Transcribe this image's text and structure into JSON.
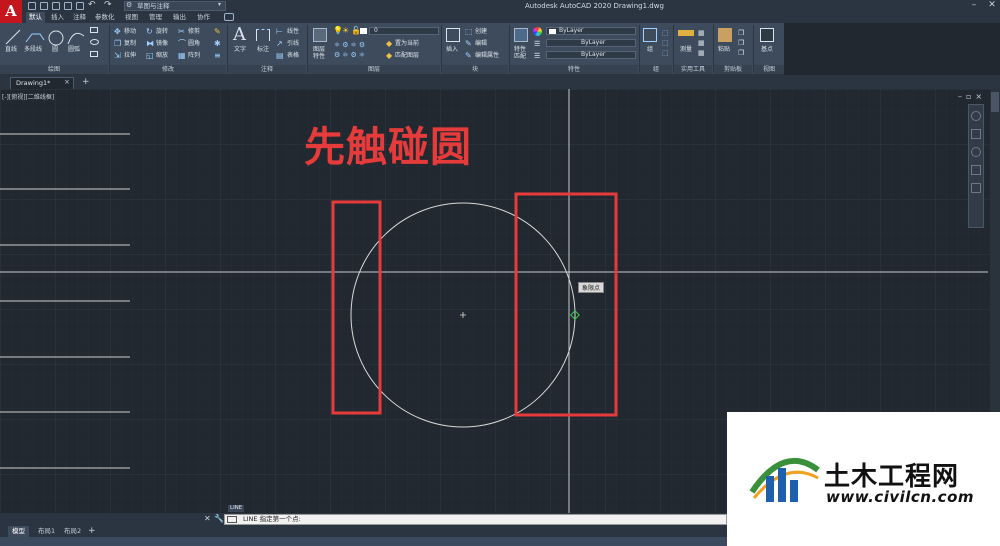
{
  "app": {
    "logo_letter": "A",
    "title": "Autodesk AutoCAD 2020    Drawing1.dwg",
    "workspace": "草图与注释"
  },
  "ribbon_tabs": [
    "默认",
    "插入",
    "注释",
    "参数化",
    "视图",
    "管理",
    "输出",
    "协作"
  ],
  "ribbon": {
    "draw": {
      "title": "绘图",
      "tools": [
        "直线",
        "多段线",
        "圆",
        "圆弧"
      ]
    },
    "modify": {
      "title": "修改",
      "rows": [
        [
          "移动",
          "旋转",
          "修剪"
        ],
        [
          "复制",
          "镜像",
          "圆角"
        ],
        [
          "拉伸",
          "缩放",
          "阵列"
        ]
      ]
    },
    "annotation": {
      "title": "注释",
      "tools": [
        "文字",
        "标注"
      ],
      "small": [
        "线性",
        "引线",
        "表格"
      ]
    },
    "layers": {
      "title": "图层",
      "big": "图层特性",
      "layer_value": "0",
      "small": [
        "置为当前",
        "匹配图层"
      ]
    },
    "block": {
      "title": "块",
      "big": "插入",
      "small": [
        "创建",
        "编辑",
        "编辑属性"
      ]
    },
    "properties": {
      "title": "特性",
      "big": "特性匹配",
      "rows": [
        "ByLayer",
        "ByLayer",
        "ByLayer"
      ]
    },
    "groups": {
      "title": "组",
      "big": "组"
    },
    "utilities": {
      "title": "实用工具",
      "big": "测量"
    },
    "clipboard": {
      "title": "剪贴板",
      "big": "粘贴"
    },
    "view": {
      "title": "视图",
      "big": "基点"
    }
  },
  "doc_tab": {
    "label": "Drawing1*"
  },
  "viewport": {
    "label": "[-][俯视][二维线框]",
    "annotation": "先触碰圆",
    "tooltip": "象限点"
  },
  "command": {
    "tag": "LINE",
    "text": "LINE 指定第一个点:"
  },
  "layout_tabs": [
    "模型",
    "布局1",
    "布局2"
  ],
  "watermark": {
    "name": "土木工程网",
    "url": "www.civilcn.com"
  },
  "colors": {
    "canvas": "#212830",
    "ribbon": "#3d4b5c",
    "annotation_red": "#e63b3b",
    "circle": "#d8d8d8",
    "snap_marker": "#3cc84a"
  }
}
